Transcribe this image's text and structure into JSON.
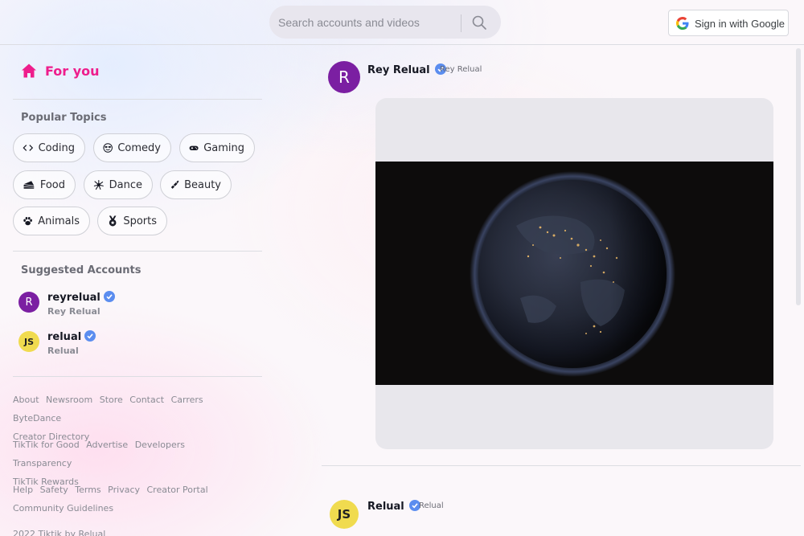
{
  "header": {
    "search_placeholder": "Search accounts and videos",
    "signin_label": "Sign in with Google"
  },
  "sidebar": {
    "for_you": "For you",
    "popular_topics_title": "Popular Topics",
    "topics": [
      {
        "label": "Coding",
        "icon": "code-icon"
      },
      {
        "label": "Comedy",
        "icon": "smile-sunglasses-icon"
      },
      {
        "label": "Gaming",
        "icon": "gamepad-icon"
      },
      {
        "label": "Food",
        "icon": "cake-icon"
      },
      {
        "label": "Dance",
        "icon": "disco-icon"
      },
      {
        "label": "Beauty",
        "icon": "lipstick-icon"
      },
      {
        "label": "Animals",
        "icon": "paw-icon"
      },
      {
        "label": "Sports",
        "icon": "medal-icon"
      }
    ],
    "suggested_title": "Suggested Accounts",
    "accounts": [
      {
        "username": "reyrelual",
        "display": "Rey Relual",
        "avatar": "R",
        "avatar_color": "#7b1fa2"
      },
      {
        "username": "relual",
        "display": "Relual",
        "avatar": "JS",
        "avatar_color": "#f0db4f"
      }
    ],
    "links_group1": [
      "About",
      "Newsroom",
      "Store",
      "Contact",
      "Carrers",
      "ByteDance",
      "Creator Directory"
    ],
    "links_group2": [
      "TikTik for Good",
      "Advertise",
      "Developers",
      "Transparency",
      "TikTik Rewards"
    ],
    "links_group3": [
      "Help",
      "Safety",
      "Terms",
      "Privacy",
      "Creator Portal",
      "Community Guidelines"
    ],
    "copyright": "2022 Tiktik by Relual"
  },
  "feed": {
    "posts": [
      {
        "name": "Rey Relual",
        "sub": "Rey Relual",
        "avatar": "R",
        "avatar_color": "#7b1fa2"
      },
      {
        "name": "Relual",
        "sub": "Relual",
        "avatar": "JS",
        "avatar_color": "#f0db4f"
      }
    ]
  },
  "colors": {
    "accent": "#ee1d8c",
    "verified": "#20d5ec"
  }
}
